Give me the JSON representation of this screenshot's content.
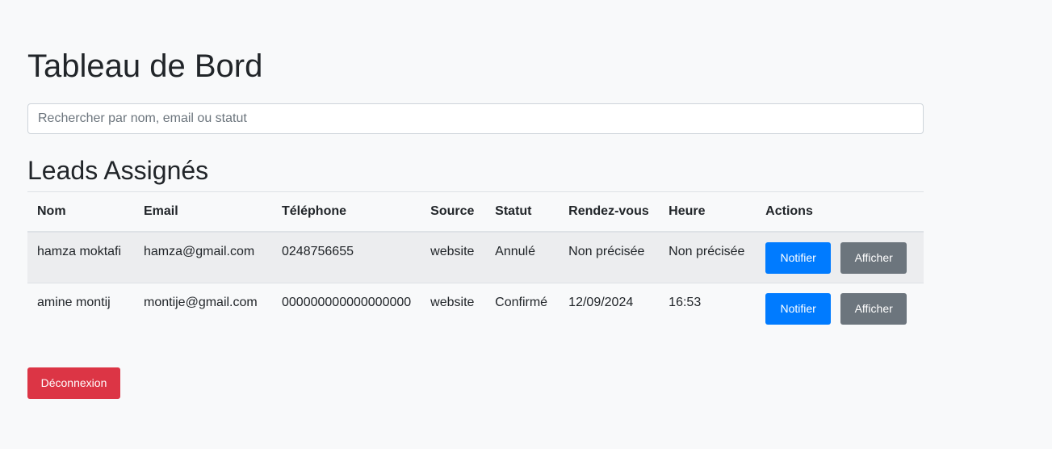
{
  "header": {
    "title": "Tableau de Bord"
  },
  "search": {
    "placeholder": "Rechercher par nom, email ou statut",
    "value": ""
  },
  "leads": {
    "section_title": "Leads Assignés",
    "columns": [
      "Nom",
      "Email",
      "Téléphone",
      "Source",
      "Statut",
      "Rendez-vous",
      "Heure",
      "Actions"
    ],
    "rows": [
      {
        "nom": "hamza moktafi",
        "email": "hamza@gmail.com",
        "telephone": "0248756655",
        "source": "website",
        "statut": "Annulé",
        "rendez_vous": "Non précisée",
        "heure": "Non précisée"
      },
      {
        "nom": "amine montij",
        "email": "montije@gmail.com",
        "telephone": "000000000000000000",
        "source": "website",
        "statut": "Confirmé",
        "rendez_vous": "12/09/2024",
        "heure": "16:53"
      }
    ],
    "actions": {
      "notify_label": "Notifier",
      "view_label": "Afficher"
    }
  },
  "logout": {
    "label": "Déconnexion"
  },
  "colors": {
    "background": "#f8f9fa",
    "primary": "#007bff",
    "secondary": "#6c757d",
    "danger": "#dc3545"
  }
}
